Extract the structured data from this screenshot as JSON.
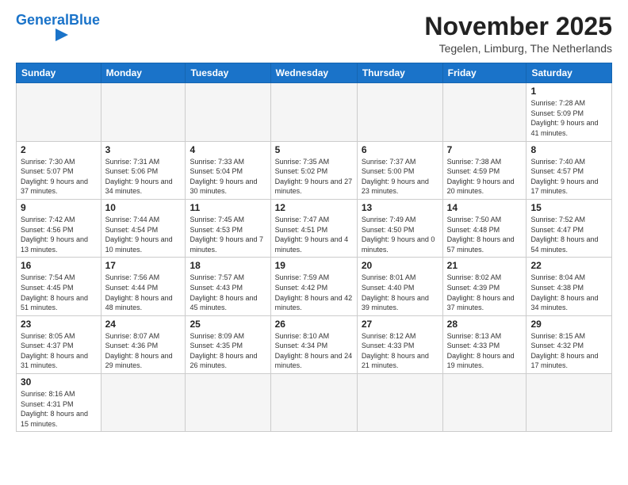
{
  "logo": {
    "text_general": "General",
    "text_blue": "Blue"
  },
  "header": {
    "month_year": "November 2025",
    "location": "Tegelen, Limburg, The Netherlands"
  },
  "weekdays": [
    "Sunday",
    "Monday",
    "Tuesday",
    "Wednesday",
    "Thursday",
    "Friday",
    "Saturday"
  ],
  "weeks": [
    [
      {
        "day": "",
        "info": ""
      },
      {
        "day": "",
        "info": ""
      },
      {
        "day": "",
        "info": ""
      },
      {
        "day": "",
        "info": ""
      },
      {
        "day": "",
        "info": ""
      },
      {
        "day": "",
        "info": ""
      },
      {
        "day": "1",
        "info": "Sunrise: 7:28 AM\nSunset: 5:09 PM\nDaylight: 9 hours\nand 41 minutes."
      }
    ],
    [
      {
        "day": "2",
        "info": "Sunrise: 7:30 AM\nSunset: 5:07 PM\nDaylight: 9 hours\nand 37 minutes."
      },
      {
        "day": "3",
        "info": "Sunrise: 7:31 AM\nSunset: 5:06 PM\nDaylight: 9 hours\nand 34 minutes."
      },
      {
        "day": "4",
        "info": "Sunrise: 7:33 AM\nSunset: 5:04 PM\nDaylight: 9 hours\nand 30 minutes."
      },
      {
        "day": "5",
        "info": "Sunrise: 7:35 AM\nSunset: 5:02 PM\nDaylight: 9 hours\nand 27 minutes."
      },
      {
        "day": "6",
        "info": "Sunrise: 7:37 AM\nSunset: 5:00 PM\nDaylight: 9 hours\nand 23 minutes."
      },
      {
        "day": "7",
        "info": "Sunrise: 7:38 AM\nSunset: 4:59 PM\nDaylight: 9 hours\nand 20 minutes."
      },
      {
        "day": "8",
        "info": "Sunrise: 7:40 AM\nSunset: 4:57 PM\nDaylight: 9 hours\nand 17 minutes."
      }
    ],
    [
      {
        "day": "9",
        "info": "Sunrise: 7:42 AM\nSunset: 4:56 PM\nDaylight: 9 hours\nand 13 minutes."
      },
      {
        "day": "10",
        "info": "Sunrise: 7:44 AM\nSunset: 4:54 PM\nDaylight: 9 hours\nand 10 minutes."
      },
      {
        "day": "11",
        "info": "Sunrise: 7:45 AM\nSunset: 4:53 PM\nDaylight: 9 hours\nand 7 minutes."
      },
      {
        "day": "12",
        "info": "Sunrise: 7:47 AM\nSunset: 4:51 PM\nDaylight: 9 hours\nand 4 minutes."
      },
      {
        "day": "13",
        "info": "Sunrise: 7:49 AM\nSunset: 4:50 PM\nDaylight: 9 hours\nand 0 minutes."
      },
      {
        "day": "14",
        "info": "Sunrise: 7:50 AM\nSunset: 4:48 PM\nDaylight: 8 hours\nand 57 minutes."
      },
      {
        "day": "15",
        "info": "Sunrise: 7:52 AM\nSunset: 4:47 PM\nDaylight: 8 hours\nand 54 minutes."
      }
    ],
    [
      {
        "day": "16",
        "info": "Sunrise: 7:54 AM\nSunset: 4:45 PM\nDaylight: 8 hours\nand 51 minutes."
      },
      {
        "day": "17",
        "info": "Sunrise: 7:56 AM\nSunset: 4:44 PM\nDaylight: 8 hours\nand 48 minutes."
      },
      {
        "day": "18",
        "info": "Sunrise: 7:57 AM\nSunset: 4:43 PM\nDaylight: 8 hours\nand 45 minutes."
      },
      {
        "day": "19",
        "info": "Sunrise: 7:59 AM\nSunset: 4:42 PM\nDaylight: 8 hours\nand 42 minutes."
      },
      {
        "day": "20",
        "info": "Sunrise: 8:01 AM\nSunset: 4:40 PM\nDaylight: 8 hours\nand 39 minutes."
      },
      {
        "day": "21",
        "info": "Sunrise: 8:02 AM\nSunset: 4:39 PM\nDaylight: 8 hours\nand 37 minutes."
      },
      {
        "day": "22",
        "info": "Sunrise: 8:04 AM\nSunset: 4:38 PM\nDaylight: 8 hours\nand 34 minutes."
      }
    ],
    [
      {
        "day": "23",
        "info": "Sunrise: 8:05 AM\nSunset: 4:37 PM\nDaylight: 8 hours\nand 31 minutes."
      },
      {
        "day": "24",
        "info": "Sunrise: 8:07 AM\nSunset: 4:36 PM\nDaylight: 8 hours\nand 29 minutes."
      },
      {
        "day": "25",
        "info": "Sunrise: 8:09 AM\nSunset: 4:35 PM\nDaylight: 8 hours\nand 26 minutes."
      },
      {
        "day": "26",
        "info": "Sunrise: 8:10 AM\nSunset: 4:34 PM\nDaylight: 8 hours\nand 24 minutes."
      },
      {
        "day": "27",
        "info": "Sunrise: 8:12 AM\nSunset: 4:33 PM\nDaylight: 8 hours\nand 21 minutes."
      },
      {
        "day": "28",
        "info": "Sunrise: 8:13 AM\nSunset: 4:33 PM\nDaylight: 8 hours\nand 19 minutes."
      },
      {
        "day": "29",
        "info": "Sunrise: 8:15 AM\nSunset: 4:32 PM\nDaylight: 8 hours\nand 17 minutes."
      }
    ],
    [
      {
        "day": "30",
        "info": "Sunrise: 8:16 AM\nSunset: 4:31 PM\nDaylight: 8 hours\nand 15 minutes."
      },
      {
        "day": "",
        "info": ""
      },
      {
        "day": "",
        "info": ""
      },
      {
        "day": "",
        "info": ""
      },
      {
        "day": "",
        "info": ""
      },
      {
        "day": "",
        "info": ""
      },
      {
        "day": "",
        "info": ""
      }
    ]
  ]
}
